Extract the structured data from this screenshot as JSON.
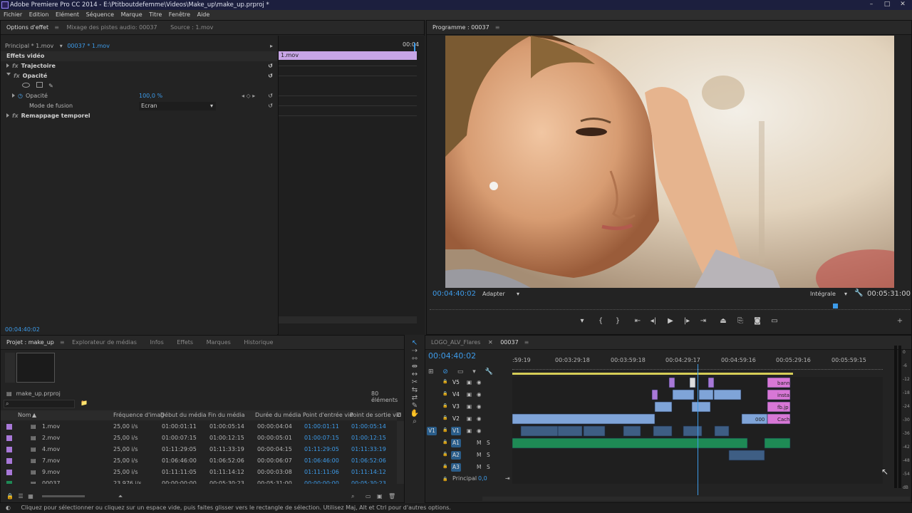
{
  "window": {
    "title": "Adobe Premiere Pro CC 2014 - E:\\Ptitboutdefemme\\Videos\\Make_up\\make_up.prproj *",
    "minimize": "–",
    "maximize": "□",
    "close": "✕"
  },
  "menu": [
    "Fichier",
    "Edition",
    "Elément",
    "Séquence",
    "Marque",
    "Titre",
    "Fenêtre",
    "Aide"
  ],
  "effect_panel": {
    "tabs": [
      "Options d'effet",
      "Mixage des pistes audio: 00037",
      "Source : 1.mov"
    ],
    "source_select": "Principal * 1.mov",
    "sequence_clip": "00037 * 1.mov",
    "timecode_top": "00:04",
    "clip_bar_label": "1.mov",
    "section_title": "Effets vidéo",
    "effects": [
      "Trajectoire",
      "Opacité",
      "Remappage temporel"
    ],
    "opacity_label": "Opacité",
    "opacity_value": "100,0 %",
    "blend_label": "Mode de fusion",
    "blend_value": "Ecran",
    "timecode_bottom": "00:04:40:02"
  },
  "program": {
    "tab": "Programme : 00037",
    "current_time": "00:04:40:02",
    "fit": "Adapter",
    "quality": "Intégrale",
    "duration": "00:05:31:00",
    "transport": [
      "marker-icon",
      "in-point-icon",
      "out-point-icon",
      "go-to-in-icon",
      "step-back-icon",
      "play-icon",
      "step-forward-icon",
      "go-to-out-icon",
      "lift-icon",
      "extract-icon",
      "export-frame-icon",
      "comment-icon"
    ]
  },
  "project": {
    "tabs": [
      "Projet : make_up",
      "Explorateur de médias",
      "Infos",
      "Effets",
      "Marques",
      "Historique"
    ],
    "file": "make_up.prproj",
    "count": "80 éléments",
    "columns": [
      "Nom",
      "Fréquence d'imag",
      "Début du média",
      "Fin du média",
      "Durée du média",
      "Point d'entrée vid",
      "Point de sortie vid",
      "D"
    ],
    "rows": [
      {
        "name": "1.mov",
        "fps": "25,00 i/s",
        "start": "01:00:01:11",
        "end": "01:00:05:14",
        "dur": "00:00:04:04",
        "in": "01:00:01:11",
        "out": "01:00:05:14"
      },
      {
        "name": "2.mov",
        "fps": "25,00 i/s",
        "start": "01:00:07:15",
        "end": "01:00:12:15",
        "dur": "00:00:05:01",
        "in": "01:00:07:15",
        "out": "01:00:12:15"
      },
      {
        "name": "4.mov",
        "fps": "25,00 i/s",
        "start": "01:11:29:05",
        "end": "01:11:33:19",
        "dur": "00:00:04:15",
        "in": "01:11:29:05",
        "out": "01:11:33:19"
      },
      {
        "name": "7.mov",
        "fps": "25,00 i/s",
        "start": "01:06:46:00",
        "end": "01:06:52:06",
        "dur": "00:00:06:07",
        "in": "01:06:46:00",
        "out": "01:06:52:06"
      },
      {
        "name": "9.mov",
        "fps": "25,00 i/s",
        "start": "01:11:11:05",
        "end": "01:11:14:12",
        "dur": "00:00:03:08",
        "in": "01:11:11:06",
        "out": "01:11:14:12"
      },
      {
        "name": "00037",
        "fps": "23,976 i/s",
        "start": "00:00:00:00",
        "end": "00:05:30:23",
        "dur": "00:05:31:00",
        "in": "00:00:00:00",
        "out": "00:05:30:23"
      }
    ]
  },
  "timeline": {
    "tabs": [
      "LOGO_ALV_Flares",
      "00037"
    ],
    "current_time": "00:04:40:02",
    "ruler": [
      ":59:19",
      "00:03:29:18",
      "00:03:59:18",
      "00:04:29:17",
      "00:04:59:16",
      "00:05:29:16",
      "00:05:59:15"
    ],
    "video_tracks": [
      "V5",
      "V4",
      "V3",
      "V2",
      "V1"
    ],
    "audio_tracks": [
      "A1",
      "A2",
      "A3"
    ],
    "source_patch": "V1",
    "master_label": "Principal",
    "master_value": "0,0",
    "clip_labels": [
      "bann",
      "insta",
      "fb.jp",
      "Cach",
      "000"
    ],
    "meter": [
      "0",
      "-6",
      "-12",
      "-18",
      "-24",
      "-30",
      "-36",
      "-42",
      "-48",
      "-54",
      "dB"
    ]
  },
  "status": "Cliquez pour sélectionner ou cliquez sur un espace vide, puis faites glisser vers le rectangle de sélection. Utilisez Maj, Alt et Ctrl pour d'autres options.",
  "colors": {
    "accent": "#3d9be9",
    "clip_video": "#7fa4d8",
    "clip_audio": "#1e8a55",
    "clip_pink": "#d877d6",
    "clip_purple": "#a878d8"
  }
}
